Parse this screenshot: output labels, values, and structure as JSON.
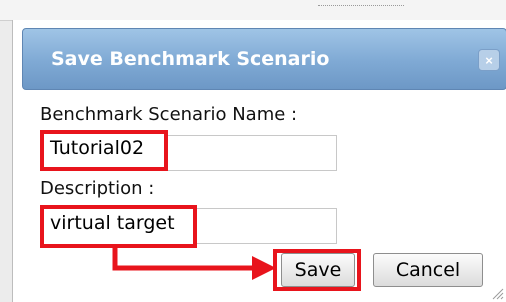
{
  "dialog": {
    "title": "Save Benchmark Scenario",
    "close_glyph": "×",
    "name_label": "Benchmark Scenario Name :",
    "name_value": "Tutorial02",
    "description_label": "Description :",
    "description_value": "virtual target",
    "save_label": "Save",
    "cancel_label": "Cancel"
  },
  "colors": {
    "titlebar": "#7fa9d4",
    "highlight": "#e8141c"
  },
  "icons": {
    "close": "close-icon",
    "arrow": "arrow-annotation",
    "grip": "resize-grip-icon"
  }
}
